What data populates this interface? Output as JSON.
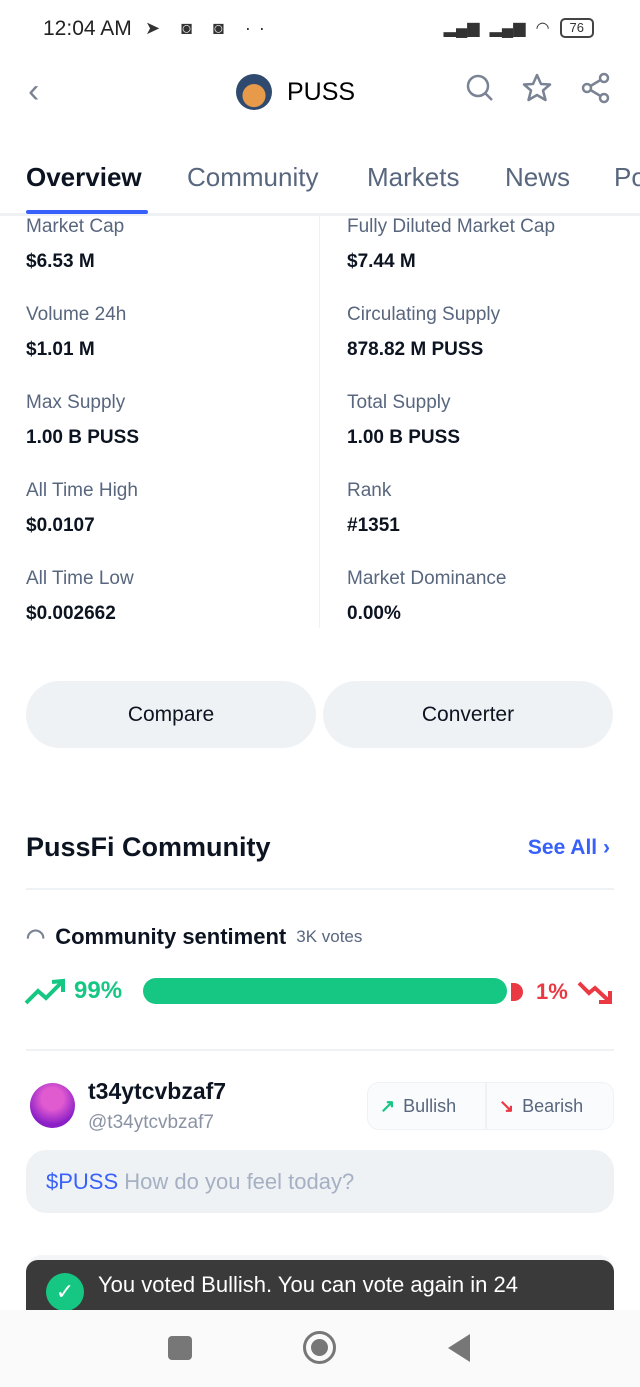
{
  "status": {
    "time": "12:04 AM",
    "battery": "76"
  },
  "header": {
    "title": "PUSS"
  },
  "tabs": [
    "Overview",
    "Community",
    "Markets",
    "News",
    "Po"
  ],
  "stats": [
    {
      "label": "Market Cap",
      "value": "$6.53 M"
    },
    {
      "label": "Fully Diluted Market Cap",
      "value": "$7.44 M"
    },
    {
      "label": "Volume 24h",
      "value": "$1.01 M"
    },
    {
      "label": "Circulating Supply",
      "value": "878.82 M PUSS"
    },
    {
      "label": "Max Supply",
      "value": "1.00 B PUSS"
    },
    {
      "label": "Total Supply",
      "value": "1.00 B PUSS"
    },
    {
      "label": "All Time High",
      "value": "$0.0107"
    },
    {
      "label": "Rank",
      "value": "#1351"
    },
    {
      "label": "All Time Low",
      "value": "$0.002662"
    },
    {
      "label": "Market Dominance",
      "value": "0.00%"
    }
  ],
  "buttons": {
    "compare": "Compare",
    "converter": "Converter"
  },
  "community": {
    "title": "PussFi Community",
    "see_all": "See All",
    "sentiment_label": "Community sentiment",
    "votes": "3K votes",
    "bullish_pct": "99%",
    "bearish_pct": "1%",
    "bullish_fraction": 0.99
  },
  "user": {
    "name": "t34ytcvbzaf7",
    "handle": "@t34ytcvbzaf7",
    "bullish": "Bullish",
    "bearish": "Bearish"
  },
  "post": {
    "ticker": "$PUSS",
    "placeholder": "How do you feel today?"
  },
  "toast": {
    "message": "You voted Bullish. You can vote again in 24"
  },
  "colors": {
    "accent": "#3861fb",
    "bullish": "#16c784",
    "bearish": "#ea3943"
  }
}
